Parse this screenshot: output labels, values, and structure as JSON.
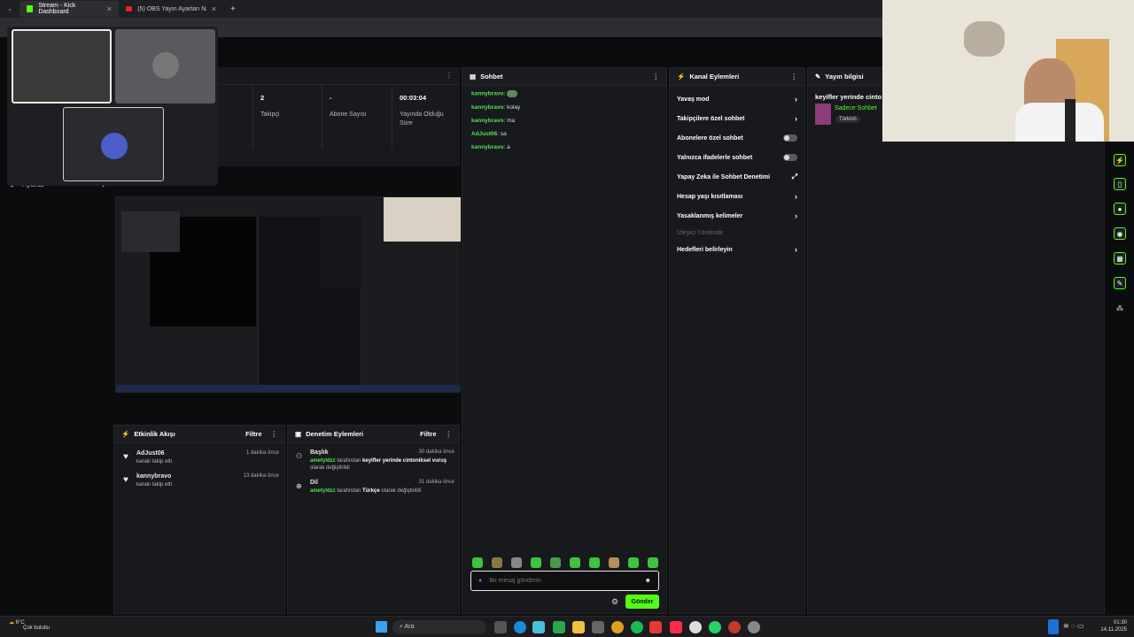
{
  "browser": {
    "tabs": [
      {
        "label": "Stream - Kick Dashboard",
        "active": true
      },
      {
        "label": "(5) OBS Yayın Ayarları Nasıl Yapı..."
      }
    ],
    "new_tab": "+"
  },
  "sidebar": {
    "settings_label": "Ayarlar"
  },
  "stats": [
    {
      "value": "2",
      "label": "Takipçi"
    },
    {
      "value": "-",
      "label": "Abone Sayısı"
    },
    {
      "value": "00:03:04",
      "label": "Yayında Olduğu Süre"
    }
  ],
  "chat": {
    "title": "Sohbet",
    "messages": [
      {
        "user": "kannybravo",
        "text": ""
      },
      {
        "user": "kannybravo",
        "text": "kolay"
      },
      {
        "user": "kannybravo",
        "text": "ma"
      },
      {
        "user": "AdJust06",
        "text": "sa"
      },
      {
        "user": "kannybravo",
        "text": "a"
      }
    ],
    "input_placeholder": "Bir mesaj gönderin",
    "send_label": "Gönder"
  },
  "channel_actions": {
    "title": "Kanal Eylemleri",
    "items": [
      {
        "label": "Yavaş mod",
        "kind": "chevron"
      },
      {
        "label": "Takipçilere özel sohbet",
        "kind": "chevron"
      },
      {
        "label": "Abonelere özel sohbet",
        "kind": "toggle"
      },
      {
        "label": "Yalnızca ifadelerle sohbet",
        "kind": "toggle"
      },
      {
        "label": "Yapay Zeka ile Sohbet Denetimi",
        "kind": "chart"
      },
      {
        "label": "Hesap yaşı kısıtlaması",
        "kind": "chevron"
      },
      {
        "label": "Yasaklanmış kelimeler",
        "kind": "chevron"
      },
      {
        "label": "İzleyici Yönlendir",
        "kind": "disabled"
      },
      {
        "label": "Hedefleri belirleyin",
        "kind": "chevron"
      }
    ]
  },
  "stream_info": {
    "title": "Yayın bilgisi",
    "stream_title": "keyifler yerinde cinto",
    "category": "Sadece Sohbet",
    "language": "Türkish"
  },
  "activity": {
    "title": "Etkinlik Akışı",
    "filter": "Filtre",
    "items": [
      {
        "user": "AdJust06",
        "action": "kanalı takip etti",
        "time": "1 dakika önce"
      },
      {
        "user": "kannybravo",
        "action": "kanalı takip etti",
        "time": "13 dakika önce"
      }
    ]
  },
  "moderation": {
    "title": "Denetim Eylemleri",
    "filter": "Filtre",
    "items": [
      {
        "title": "Başlık",
        "user": "ametyldzz",
        "pre": " tarafından ",
        "value": "keyifler yerinde cintoniksel vuruş",
        "post": " olarak değiştirildi",
        "time": "30 dakika önce"
      },
      {
        "title": "Dil",
        "user": "ametyldzz",
        "pre": " tarafından ",
        "value": "Türkçe",
        "post": " olarak değiştirildi",
        "time": "31 dakika önce"
      }
    ]
  },
  "taskbar": {
    "weather_temp": "6°C",
    "weather_text": "Çok bulutlu",
    "search": "Ara",
    "time": "01:30",
    "date": "14.11.2025"
  },
  "colors": {
    "accent": "#53fc18",
    "username": "#52e252"
  }
}
